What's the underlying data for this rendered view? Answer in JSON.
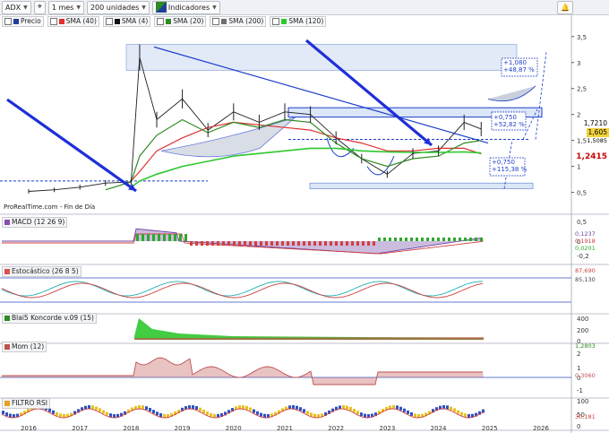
{
  "toolbar": {
    "symbol": "ADX",
    "timeframe": "1 mes",
    "units": "200 unidades",
    "indicators_label": "Indicadores"
  },
  "legend": [
    {
      "label": "Precio",
      "color": "#1f3f9a"
    },
    {
      "label": "SMA (40)",
      "color": "#e03030"
    },
    {
      "label": "SMA (4)",
      "color": "#111111"
    },
    {
      "label": "SMA (20)",
      "color": "#2e8b22"
    },
    {
      "label": "SMA (200)",
      "color": "#6e6e6e"
    },
    {
      "label": "SMA (120)",
      "color": "#2ec82e"
    }
  ],
  "source_note": "ProRealTime.com - Fin de Día",
  "panels": {
    "macd": {
      "label": "MACD (12 26 9)",
      "ticks": [
        "0,5",
        "0",
        "-0,2"
      ],
      "values": [
        "0,1237",
        "0,1918",
        "0,0201"
      ]
    },
    "stoch": {
      "label": "Estocástico (26 8 5)",
      "values": [
        "87,690",
        "85,130"
      ]
    },
    "blai5": {
      "label": "Blai5 Koncorde v.09 (15)",
      "ticks": [
        "400",
        "200",
        "0"
      ],
      "values": [
        "1,2803"
      ]
    },
    "mom": {
      "label": "Mom (12)",
      "ticks": [
        "2",
        "1",
        "0",
        "-1"
      ],
      "values": [
        "0,3060"
      ]
    },
    "rsi": {
      "label": "FILTRO RSI",
      "ticks": [
        "100",
        "50",
        "0"
      ],
      "values": [
        "30,181"
      ]
    }
  },
  "price_axis": [
    "3,5",
    "3",
    "2,5",
    "2",
    "1,5",
    "1",
    "0,5"
  ],
  "price_tags": [
    {
      "text": "1,7210",
      "bg": "#ffffff",
      "fg": "#000000"
    },
    {
      "text": "1,605",
      "bg": "#f2d23a",
      "fg": "#000000"
    },
    {
      "text": "1,5085",
      "bg": "#ffffff",
      "fg": "#333333"
    },
    {
      "text": "1,2415",
      "bg": "#ffffff",
      "fg": "#cc0000"
    }
  ],
  "annotations": [
    {
      "line1": "+1,080",
      "line2": "+48,87 %"
    },
    {
      "line1": "+0,750",
      "line2": "+52,82 %"
    },
    {
      "line1": "+0,750",
      "line2": "+115,38 %"
    }
  ],
  "x_axis": [
    "2016",
    "2017",
    "2018",
    "2019",
    "2020",
    "2021",
    "2022",
    "2023",
    "2024",
    "2025",
    "2026"
  ],
  "chart_data": {
    "type": "line",
    "title": "ADX",
    "timeframe": "1 mes",
    "x": [
      "2016-01",
      "2016-07",
      "2017-01",
      "2017-07",
      "2018-01",
      "2018-03",
      "2018-07",
      "2019-01",
      "2019-07",
      "2020-01",
      "2020-07",
      "2021-01",
      "2021-07",
      "2022-01",
      "2022-07",
      "2023-01",
      "2023-07",
      "2024-01",
      "2024-07",
      "2024-11"
    ],
    "series": [
      {
        "name": "Precio",
        "values": [
          0.52,
          0.55,
          0.6,
          0.68,
          0.7,
          3.1,
          1.9,
          2.3,
          1.7,
          2.05,
          1.85,
          2.05,
          2.0,
          1.55,
          1.15,
          0.85,
          1.25,
          1.3,
          1.85,
          1.72
        ]
      },
      {
        "name": "SMA (40)",
        "values": [
          null,
          null,
          null,
          null,
          0.72,
          0.9,
          1.3,
          1.55,
          1.75,
          1.85,
          1.8,
          1.75,
          1.7,
          1.55,
          1.45,
          1.3,
          1.3,
          1.35,
          1.35,
          1.24
        ]
      },
      {
        "name": "SMA (20)",
        "values": [
          null,
          null,
          null,
          0.55,
          0.7,
          1.2,
          1.6,
          1.9,
          1.65,
          1.85,
          1.75,
          1.9,
          1.85,
          1.45,
          1.15,
          1.0,
          1.15,
          1.2,
          1.45,
          1.5
        ]
      },
      {
        "name": "SMA (120)",
        "values": [
          null,
          null,
          null,
          null,
          0.6,
          0.72,
          0.85,
          1.0,
          1.1,
          1.2,
          1.25,
          1.3,
          1.35,
          1.35,
          1.3,
          1.28,
          1.27,
          1.27,
          1.28,
          1.26
        ]
      }
    ],
    "ylim": [
      0.2,
      3.6
    ],
    "ylabel": "",
    "current_price": "1,605",
    "last": "1,7210"
  }
}
